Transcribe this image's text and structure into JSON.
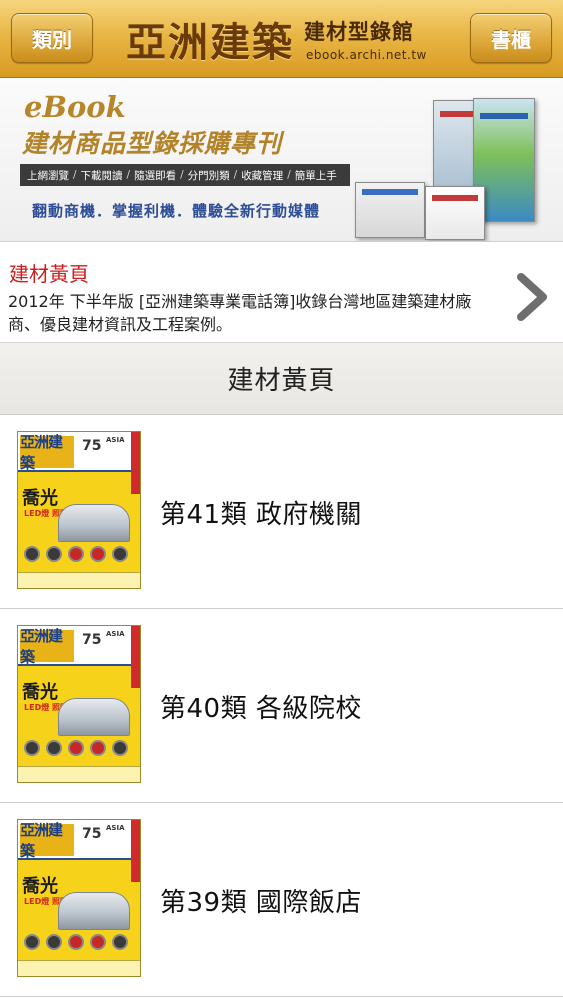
{
  "header": {
    "left_button": "類別",
    "brand_main": "亞洲建築",
    "brand_sub": "建材型錄館",
    "brand_url": "ebook.archi.net.tw",
    "right_button": "書櫃"
  },
  "banner": {
    "ebook_label": "eBook",
    "title": "建材商品型錄採購專刊",
    "tags": [
      "上網瀏覽",
      "下載閱讀",
      "隨選即看",
      "分門別類",
      "收藏管理",
      "簡單上手"
    ],
    "slogan": "翻動商機．掌握利機．體驗全新行動媒體"
  },
  "featured": {
    "title": "建材黃頁",
    "description": "2012年 下半年版 [亞洲建築專業電話簿]收錄台灣地區建築建材廠商、優良建材資訊及工程案例。",
    "chevron_icon": "chevron-right-icon"
  },
  "section": {
    "header": "建材黃頁"
  },
  "cover": {
    "logo": "亞洲建築",
    "number": "75",
    "asia": "ASIA",
    "brand": "喬光",
    "led": "LED燈 照明"
  },
  "list": [
    {
      "label": "第41類 政府機關"
    },
    {
      "label": "第40類 各級院校"
    },
    {
      "label": "第39類 國際飯店"
    }
  ],
  "colors": {
    "nav_gold": "#e9b645",
    "featured_red": "#cc1f1f",
    "slogan_blue": "#2d4d98"
  }
}
